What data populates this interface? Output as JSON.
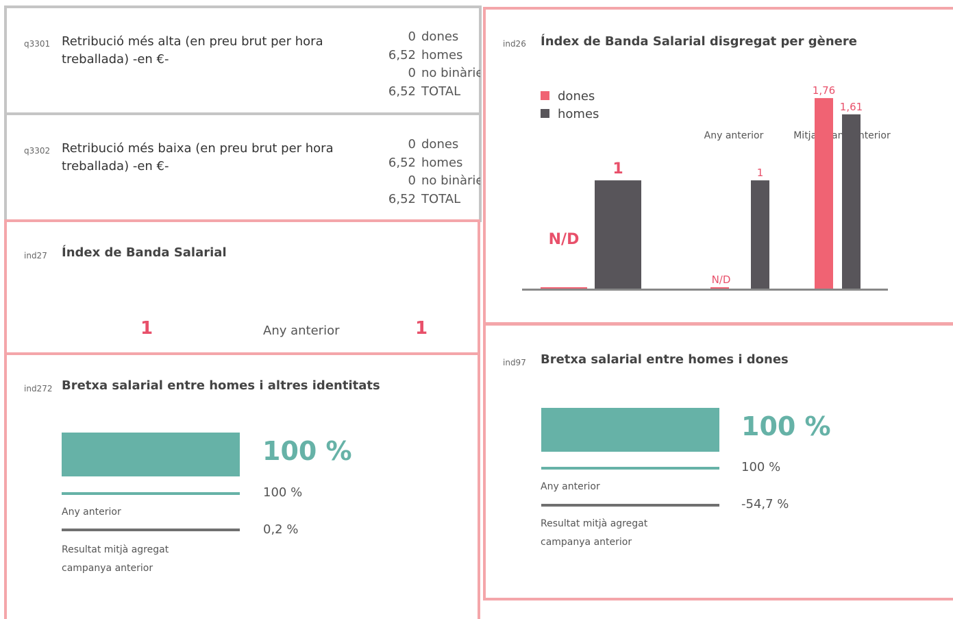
{
  "q3301": {
    "code": "q3301",
    "label": "Retribució  més alta (en preu brut per hora treballada) -en €-",
    "rows": [
      {
        "value": "0",
        "label": "dones"
      },
      {
        "value": "6,52",
        "label": "homes"
      },
      {
        "value": "0",
        "label": "no binàrie"
      },
      {
        "value": "6,52",
        "label": "TOTAL"
      }
    ]
  },
  "q3302": {
    "code": "q3302",
    "label": "Retribució més baixa (en preu brut per hora treballada) -en €-",
    "rows": [
      {
        "value": "0",
        "label": "dones"
      },
      {
        "value": "6,52",
        "label": "homes"
      },
      {
        "value": "0",
        "label": "no binàrie"
      },
      {
        "value": "6,52",
        "label": "TOTAL"
      }
    ]
  },
  "ind27": {
    "code": "ind27",
    "title": "Índex de Banda Salarial",
    "value": "1",
    "prev_label": "Any anterior",
    "prev_value": "1"
  },
  "ind272": {
    "code": "ind272",
    "title": "Bretxa salarial entre homes i altres identitats",
    "value": "100 %",
    "bar_fraction": 1.0,
    "prev_value": "100 %",
    "prev_label": "Any anterior",
    "avg_value": "0,2 %",
    "avg_label_1": "Resultat mitjà agregat",
    "avg_label_2": "campanya anterior"
  },
  "ind26": {
    "code": "ind26",
    "title": "Índex de Banda Salarial disgregat per gènere",
    "legend": [
      {
        "label": "dones",
        "color": "#f06373"
      },
      {
        "label": "homes",
        "color": "#58555a"
      }
    ],
    "group_prev_label": "Any anterior",
    "group_avg_label": "Mitjana any anterior"
  },
  "ind97": {
    "code": "ind97",
    "title": "Bretxa salarial entre homes i dones",
    "value": "100 %",
    "bar_fraction": 1.0,
    "prev_value": "100 %",
    "prev_label": "Any anterior",
    "avg_value": "-54,7 %",
    "avg_label_1": "Resultat mitjà agregat",
    "avg_label_2": "campanya anterior"
  },
  "colors": {
    "pink_border": "#f4a6aa",
    "gray_border": "#c5c5c5",
    "teal": "#66b2a7",
    "red": "#e8506a",
    "dark": "#58555a",
    "gray_line": "#707070"
  },
  "chart_data": {
    "type": "bar",
    "title": "Índex de Banda Salarial disgregat per gènere",
    "legend_position": "top-left",
    "grid": false,
    "ylim": [
      0,
      1.9
    ],
    "groups": [
      {
        "name": "",
        "bars": [
          {
            "series": "dones",
            "value": null,
            "label": "N/D"
          },
          {
            "series": "homes",
            "value": 1,
            "label": "1"
          }
        ]
      },
      {
        "name": "Any anterior",
        "bars": [
          {
            "series": "dones",
            "value": null,
            "label": "N/D"
          },
          {
            "series": "homes",
            "value": 1,
            "label": "1"
          }
        ]
      },
      {
        "name": "Mitjana any anterior",
        "bars": [
          {
            "series": "dones",
            "value": 1.76,
            "label": "1,76"
          },
          {
            "series": "homes",
            "value": 1.61,
            "label": "1,61"
          }
        ]
      }
    ]
  }
}
